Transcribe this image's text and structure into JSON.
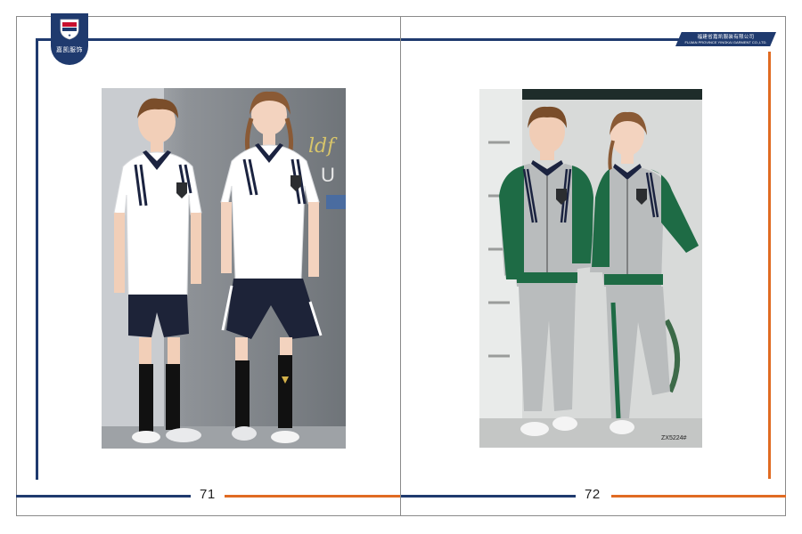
{
  "brand": {
    "logo_text": "嘉凯服饰",
    "company_cn": "福建省嘉凯服装有限公司",
    "company_en": "FUJIAN PROVINCE YINGKAI GARMENT CO.,LTD."
  },
  "pages": {
    "left": {
      "number": "71"
    },
    "right": {
      "number": "72",
      "product_code": "ZX5224#"
    }
  },
  "photos": {
    "left": {
      "subject": "summer-uniform-polo-and-shorts",
      "backdrop_text": "U"
    },
    "right": {
      "subject": "tracksuit-jacket-and-pants"
    }
  },
  "colors": {
    "navy": "#1f3a6e",
    "orange": "#e06b22",
    "uniform_green": "#1e6b45",
    "uniform_grey": "#b9bcbd"
  }
}
